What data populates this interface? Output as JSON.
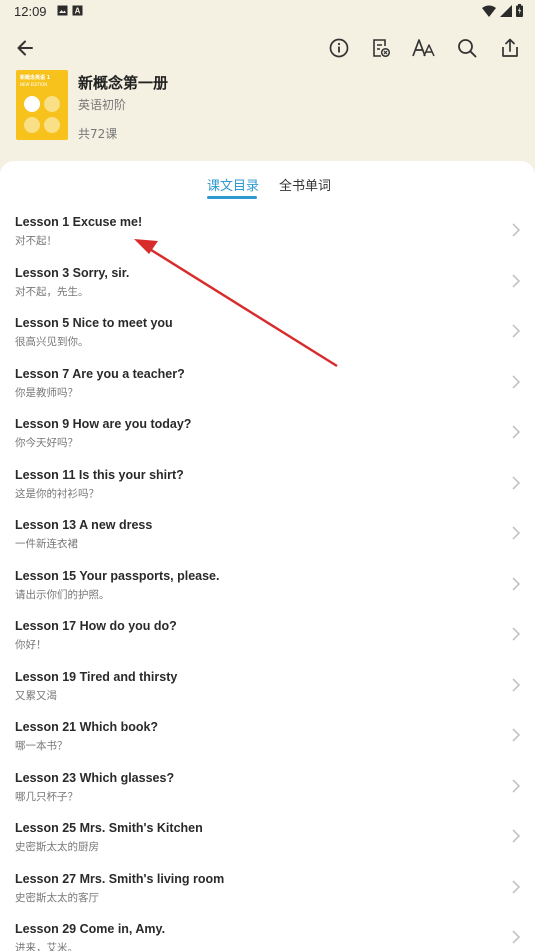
{
  "status_bar": {
    "time": "12:09",
    "icons": [
      "image-icon",
      "a-box-icon",
      "wifi-icon",
      "signal-icon",
      "battery-icon"
    ]
  },
  "toolbar": {
    "icons": [
      "back-arrow-icon",
      "info-icon",
      "notes-icon",
      "font-size-icon",
      "search-icon",
      "share-icon"
    ]
  },
  "book": {
    "title": "新概念第一册",
    "level": "英语初阶",
    "lesson_count": "共72课",
    "cover_title": "新概念英语 1",
    "cover_subtitle": "NEW EDITION"
  },
  "tabs": [
    {
      "label": "课文目录",
      "active": true
    },
    {
      "label": "全书单词",
      "active": false
    }
  ],
  "lessons": [
    {
      "title": "Lesson 1 Excuse me!",
      "subtitle": "对不起！"
    },
    {
      "title": "Lesson 3 Sorry, sir.",
      "subtitle": "对不起，先生。"
    },
    {
      "title": "Lesson 5 Nice to meet you",
      "subtitle": "很高兴见到你。"
    },
    {
      "title": "Lesson 7 Are you a teacher?",
      "subtitle": "你是教师吗？"
    },
    {
      "title": "Lesson 9 How are you today?",
      "subtitle": "你今天好吗？"
    },
    {
      "title": "Lesson 11 Is this your shirt?",
      "subtitle": "这是你的衬衫吗？"
    },
    {
      "title": "Lesson 13 A new dress",
      "subtitle": "一件新连衣裙"
    },
    {
      "title": "Lesson 15 Your passports, please.",
      "subtitle": "请出示你们的护照。"
    },
    {
      "title": "Lesson 17 How do you do?",
      "subtitle": "你好！"
    },
    {
      "title": "Lesson 19 Tired and thirsty",
      "subtitle": "又累又渴"
    },
    {
      "title": "Lesson 21 Which book?",
      "subtitle": "哪一本书？"
    },
    {
      "title": "Lesson 23 Which glasses?",
      "subtitle": "哪几只杯子？"
    },
    {
      "title": "Lesson 25 Mrs. Smith's Kitchen",
      "subtitle": "史密斯太太的厨房"
    },
    {
      "title": "Lesson 27 Mrs. Smith's living room",
      "subtitle": "史密斯太太的客厅"
    },
    {
      "title": "Lesson 29 Come in, Amy.",
      "subtitle": "进来，艾米。"
    }
  ],
  "colors": {
    "background": "#f5f1e2",
    "accent": "#2f9ad0",
    "cover": "#f6c21b",
    "annotation_arrow": "#d82c2c"
  }
}
